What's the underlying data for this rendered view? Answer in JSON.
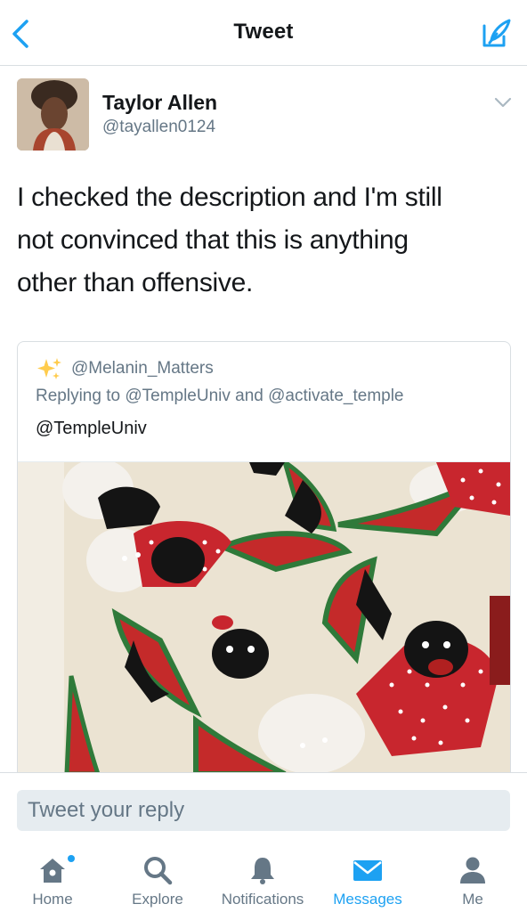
{
  "colors": {
    "accent": "#1da1f2",
    "secondary_text": "#657786",
    "primary_text": "#14171a",
    "border": "#d9dee2"
  },
  "navbar": {
    "title": "Tweet",
    "back_icon": "chevron-left-icon",
    "compose_icon": "compose-tweet-icon"
  },
  "tweet": {
    "author_name": "Taylor Allen",
    "author_handle": "@tayallen0124",
    "text_lines": [
      "I checked the description and I'm still",
      "not convinced that this is anything",
      "other than offensive."
    ],
    "menu_icon": "chevron-down-icon"
  },
  "quoted_tweet": {
    "handle": "@Melanin_Matters",
    "replying_to": "Replying to @TempleUniv and @activate_temple",
    "text": "@TempleUniv",
    "sparkle_icon": "sparkles-icon"
  },
  "reply": {
    "placeholder": "Tweet your reply"
  },
  "tabbar": {
    "tabs": [
      {
        "label": "Home",
        "icon": "home-icon",
        "active": false
      },
      {
        "label": "Explore",
        "icon": "search-icon",
        "active": false
      },
      {
        "label": "Notifications",
        "icon": "bell-icon",
        "active": false
      },
      {
        "label": "Messages",
        "icon": "envelope-icon",
        "active": true
      },
      {
        "label": "Me",
        "icon": "person-icon",
        "active": false
      }
    ]
  }
}
